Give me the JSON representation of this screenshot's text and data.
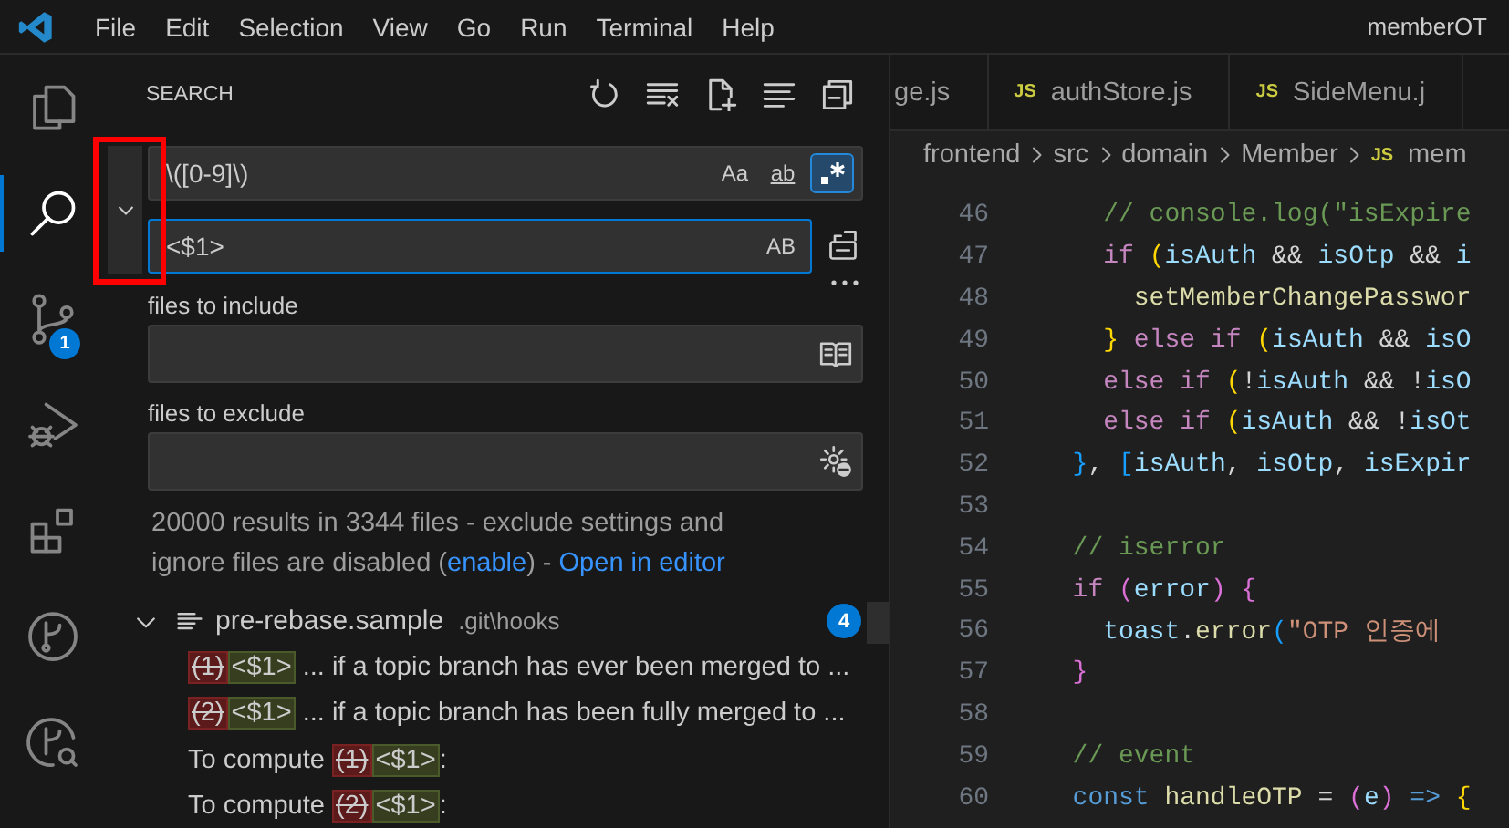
{
  "title_bar": {
    "menu": [
      "File",
      "Edit",
      "Selection",
      "View",
      "Go",
      "Run",
      "Terminal",
      "Help"
    ],
    "title": "memberOT"
  },
  "activity_bar": [
    {
      "kind": "files",
      "selected": false
    },
    {
      "kind": "search",
      "selected": true
    },
    {
      "kind": "source-control",
      "selected": false,
      "badge": "1"
    },
    {
      "kind": "run-debug",
      "selected": false
    },
    {
      "kind": "extensions",
      "selected": false
    },
    {
      "kind": "branch",
      "selected": false
    },
    {
      "kind": "branch-search",
      "selected": false
    }
  ],
  "sidebar": {
    "title": "SEARCH",
    "highlight_box": true,
    "replace_expanded": true,
    "search": {
      "value": "\\([0-9]\\)",
      "options": [
        {
          "kind": "case",
          "label": "Aa",
          "selected": false
        },
        {
          "kind": "word",
          "label": "ab",
          "selected": false
        },
        {
          "kind": "regex",
          "selected": true
        }
      ]
    },
    "replace": {
      "value": "<$1>",
      "focused": true,
      "preserve_case": {
        "label": "AB",
        "selected": false
      }
    },
    "include": {
      "label": "files to include"
    },
    "exclude": {
      "label": "files to exclude"
    },
    "message": [
      {
        "kind": "text",
        "text": "20000 results in 3344 files - exclude settings and ignore files are disabled ("
      },
      {
        "kind": "link",
        "text": "enable"
      },
      {
        "kind": "text",
        "text": ") - "
      },
      {
        "kind": "link",
        "text": "Open in editor"
      }
    ],
    "results": [
      {
        "file": "pre-rebase.sample",
        "path": ".git\\hooks",
        "count": "4",
        "expanded": true,
        "matches": [
          {
            "removed": "(1)",
            "inserted": "<$1>",
            "after": " ... if a topic branch has ever been merged to ..."
          },
          {
            "removed": "(2)",
            "inserted": "<$1>",
            "after": " ... if a topic branch has been fully merged to ..."
          },
          {
            "before": "To compute ",
            "removed": "(1)",
            "inserted": "<$1>",
            "after": ":"
          },
          {
            "before": "To compute ",
            "removed": "(2)",
            "inserted": "<$1>",
            "after": ":"
          }
        ]
      }
    ]
  },
  "editor": {
    "tabs": [
      {
        "label": "ge.js",
        "selected": false
      },
      {
        "icon": "JS",
        "label": "authStore.js",
        "selected": false
      },
      {
        "icon": "JS",
        "label": "SideMenu.j",
        "selected": false
      }
    ],
    "breadcrumb": [
      {
        "label": "frontend"
      },
      {
        "label": "src"
      },
      {
        "label": "domain"
      },
      {
        "label": "Member"
      },
      {
        "icon": "JS",
        "label": "mem"
      }
    ],
    "lines": [
      {
        "number": "46",
        "tokens": [
          {
            "kind": "comment",
            "text": "    // console.log(\"isExpire"
          }
        ]
      },
      {
        "number": "47",
        "tokens": [
          {
            "kind": "kw",
            "text": "    if"
          },
          {
            "kind": "b1",
            "text": " ("
          },
          {
            "kind": "var",
            "text": "isAuth"
          },
          {
            "kind": "punct",
            "text": " && "
          },
          {
            "kind": "var",
            "text": "isOtp"
          },
          {
            "kind": "punct",
            "text": " && "
          },
          {
            "kind": "var",
            "text": "i"
          }
        ]
      },
      {
        "number": "48",
        "tokens": [
          {
            "kind": "fn",
            "text": "      setMemberChangePasswor"
          }
        ]
      },
      {
        "number": "49",
        "tokens": [
          {
            "kind": "b1",
            "text": "    }"
          },
          {
            "kind": "kw",
            "text": " else if"
          },
          {
            "kind": "b1",
            "text": " ("
          },
          {
            "kind": "var",
            "text": "isAuth"
          },
          {
            "kind": "punct",
            "text": " && "
          },
          {
            "kind": "var",
            "text": "isO"
          }
        ]
      },
      {
        "number": "50",
        "tokens": [
          {
            "kind": "kw",
            "text": "    else if"
          },
          {
            "kind": "b1",
            "text": " ("
          },
          {
            "kind": "punct",
            "text": "!"
          },
          {
            "kind": "var",
            "text": "isAuth"
          },
          {
            "kind": "punct",
            "text": " && !"
          },
          {
            "kind": "var",
            "text": "isO"
          }
        ]
      },
      {
        "number": "51",
        "tokens": [
          {
            "kind": "kw",
            "text": "    else if"
          },
          {
            "kind": "b1",
            "text": " ("
          },
          {
            "kind": "var",
            "text": "isAuth"
          },
          {
            "kind": "punct",
            "text": " && !"
          },
          {
            "kind": "var",
            "text": "isOt"
          }
        ]
      },
      {
        "number": "52",
        "tokens": [
          {
            "kind": "b3",
            "text": "  }"
          },
          {
            "kind": "punct",
            "text": ", "
          },
          {
            "kind": "b3",
            "text": "["
          },
          {
            "kind": "var",
            "text": "isAuth"
          },
          {
            "kind": "punct",
            "text": ", "
          },
          {
            "kind": "var",
            "text": "isOtp"
          },
          {
            "kind": "punct",
            "text": ", "
          },
          {
            "kind": "var",
            "text": "isExpir"
          }
        ]
      },
      {
        "number": "53"
      },
      {
        "number": "54",
        "tokens": [
          {
            "kind": "comment",
            "text": "  // iserror"
          }
        ]
      },
      {
        "number": "55",
        "tokens": [
          {
            "kind": "kw",
            "text": "  if"
          },
          {
            "kind": "b2",
            "text": " ("
          },
          {
            "kind": "var",
            "text": "error"
          },
          {
            "kind": "b2",
            "text": ") {"
          }
        ]
      },
      {
        "number": "56",
        "tokens": [
          {
            "kind": "var",
            "text": "    toast"
          },
          {
            "kind": "punct",
            "text": "."
          },
          {
            "kind": "fn",
            "text": "error"
          },
          {
            "kind": "b3",
            "text": "("
          },
          {
            "kind": "str",
            "text": "\"OTP 인증에"
          }
        ]
      },
      {
        "number": "57",
        "tokens": [
          {
            "kind": "b2",
            "text": "  }"
          }
        ]
      },
      {
        "number": "58"
      },
      {
        "number": "59",
        "tokens": [
          {
            "kind": "comment",
            "text": "  // event"
          }
        ]
      },
      {
        "number": "60",
        "tokens": [
          {
            "kind": "const",
            "text": "  const"
          },
          {
            "kind": "fn",
            "text": " handleOTP"
          },
          {
            "kind": "punct",
            "text": " = "
          },
          {
            "kind": "b2",
            "text": "("
          },
          {
            "kind": "var",
            "text": "e"
          },
          {
            "kind": "b2",
            "text": ")"
          },
          {
            "kind": "const",
            "text": " =>"
          },
          {
            "kind": "b1",
            "text": " {"
          }
        ]
      }
    ]
  }
}
